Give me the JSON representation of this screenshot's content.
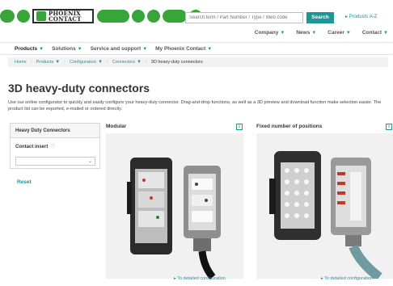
{
  "logo": {
    "text_line1": "PHOENIX",
    "text_line2": "CONTACT"
  },
  "search": {
    "placeholder": "Search term / Part Number / Type / Web code",
    "button_label": "Search"
  },
  "products_az": "Products A-Z",
  "utility_nav": [
    "Company",
    "News",
    "Career",
    "Contact"
  ],
  "main_nav": [
    "Products",
    "Solutions",
    "Service and support",
    "My Phoenix Contact"
  ],
  "breadcrumb": [
    "Home",
    "Products",
    "Configurators",
    "Connectors",
    "3D heavy-duty connectors"
  ],
  "page": {
    "title": "3D heavy-duty connectors",
    "intro": "Use our online configurator to quickly and easily configure your heavy-duty connector. Drag-and-drop functions, as well as a 3D preview and download function make selection easier. The product list can be exported, e-mailed or ordered directly."
  },
  "filter": {
    "heading": "Heavy Duty Connectors",
    "contact_insert_label": "Contact insert",
    "contact_insert_value": "",
    "reset_label": "Reset"
  },
  "cards": [
    {
      "title": "Modular",
      "link": "To detailed configuration"
    },
    {
      "title": "Fixed number of positions",
      "link": "To detailed configuration"
    }
  ],
  "colors": {
    "brand_green": "#37a53a",
    "accent_teal": "#1d9696"
  }
}
